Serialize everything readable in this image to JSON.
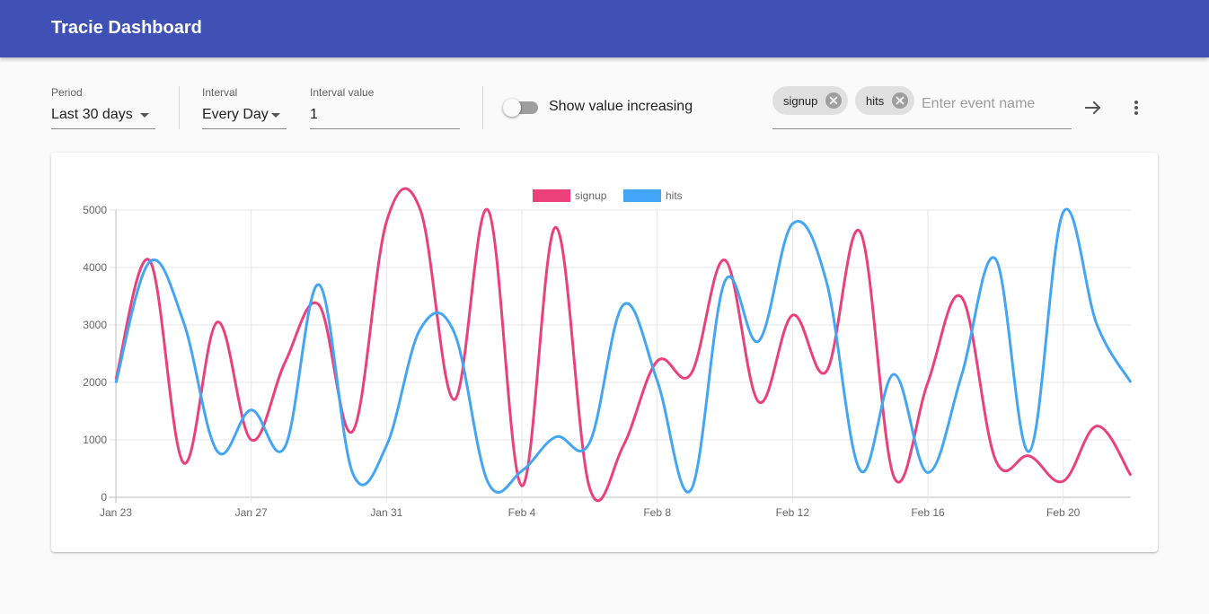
{
  "appbar": {
    "title": "Tracie Dashboard"
  },
  "controls": {
    "period": {
      "label": "Period",
      "value": "Last 30 days"
    },
    "interval": {
      "label": "Interval",
      "value": "Every Day"
    },
    "interval_value": {
      "label": "Interval value",
      "value": "1"
    },
    "toggle": {
      "label": "Show value increasing",
      "on": false
    },
    "chips": [
      {
        "label": "signup"
      },
      {
        "label": "hits"
      }
    ],
    "event_input": {
      "placeholder": "Enter event name"
    }
  },
  "icons": {
    "submit": "arrow-right-icon",
    "menu": "more-vert-icon",
    "chip_delete": "cancel-icon",
    "dropdown": "arrow-drop-down-icon"
  },
  "colors": {
    "appbar": "#3f51b5",
    "signup": "#ec407a",
    "hits": "#42a5f5"
  },
  "chart_data": {
    "type": "line",
    "x": [
      "Jan 23",
      "Jan 24",
      "Jan 25",
      "Jan 26",
      "Jan 27",
      "Jan 28",
      "Jan 29",
      "Jan 30",
      "Jan 31",
      "Feb 1",
      "Feb 2",
      "Feb 3",
      "Feb 4",
      "Feb 5",
      "Feb 6",
      "Feb 7",
      "Feb 8",
      "Feb 9",
      "Feb 10",
      "Feb 11",
      "Feb 12",
      "Feb 13",
      "Feb 14",
      "Feb 15",
      "Feb 16",
      "Feb 17",
      "Feb 18",
      "Feb 19",
      "Feb 20",
      "Feb 21",
      "Feb 22"
    ],
    "x_tick_labels": [
      "Jan 23",
      "Jan 27",
      "Jan 31",
      "Feb 4",
      "Feb 8",
      "Feb 12",
      "Feb 16",
      "Feb 20"
    ],
    "series": [
      {
        "name": "signup",
        "color": "#ec407a",
        "values": [
          2050,
          4120,
          600,
          3050,
          1000,
          2350,
          3350,
          1150,
          4800,
          5000,
          1700,
          5000,
          200,
          4700,
          170,
          900,
          2370,
          2150,
          4130,
          1660,
          3170,
          2190,
          4620,
          350,
          2000,
          3480,
          650,
          720,
          280,
          1240,
          380
        ]
      },
      {
        "name": "hits",
        "color": "#42a5f5",
        "values": [
          1990,
          4100,
          3050,
          800,
          1520,
          880,
          3700,
          420,
          900,
          2930,
          2870,
          260,
          460,
          1050,
          950,
          3350,
          2030,
          130,
          3760,
          2720,
          4760,
          3760,
          470,
          2140,
          430,
          2130,
          4150,
          800,
          4960,
          3000,
          2000
        ]
      }
    ],
    "y_ticks": [
      "0",
      "1000",
      "2000",
      "3000",
      "4000",
      "5000"
    ],
    "ylim": [
      0,
      5000
    ],
    "grid": true,
    "legend": "top-center"
  }
}
